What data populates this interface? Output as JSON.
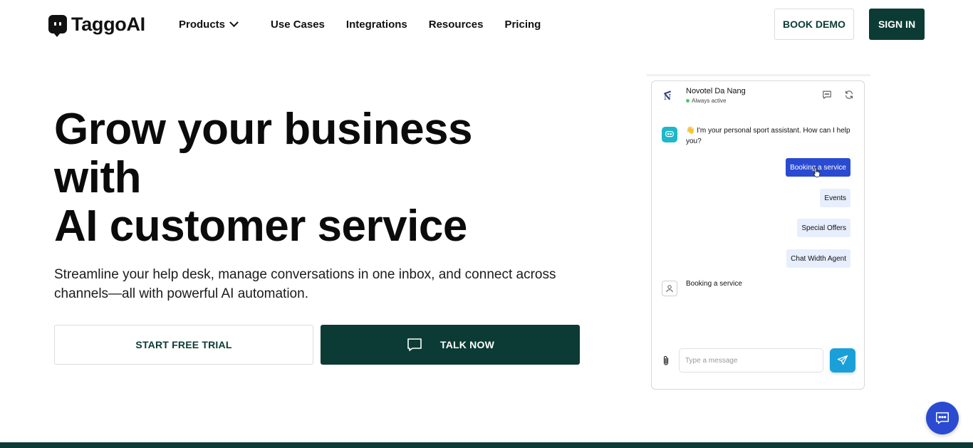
{
  "brand": {
    "name": "TaggoAI",
    "primary_color": "#0c3b35",
    "accent_color": "#2a4bd1"
  },
  "nav": {
    "links": [
      {
        "label": "Products",
        "has_dropdown": true
      },
      {
        "label": "Use Cases"
      },
      {
        "label": "Integrations"
      },
      {
        "label": "Resources"
      },
      {
        "label": "Pricing"
      }
    ],
    "book_demo": "BOOK DEMO",
    "sign_in": "SIGN IN"
  },
  "hero": {
    "title_line1": "Grow your business",
    "title_line2": "with",
    "title_line3": "AI customer service",
    "subtitle": "Streamline your help desk, manage conversations in one inbox, and connect across channels—all with powerful AI automation.",
    "cta_trial": "START FREE TRIAL",
    "cta_talk": "TALK NOW"
  },
  "chat_preview": {
    "business_name": "Novotel Da Nang",
    "status": "Always active",
    "bot_message": "👋 I'm your personal sport assistant. How can I help you?",
    "options": [
      {
        "label": "Booking a service",
        "active": true
      },
      {
        "label": "Events",
        "active": false
      },
      {
        "label": "Special Offers",
        "active": false
      },
      {
        "label": "Chat Width Agent",
        "active": false
      }
    ],
    "user_message": "Booking a service",
    "input_placeholder": "Type a message",
    "icons": [
      "chat-bubble-icon",
      "refresh-icon",
      "paperclip-icon",
      "send-icon"
    ]
  }
}
